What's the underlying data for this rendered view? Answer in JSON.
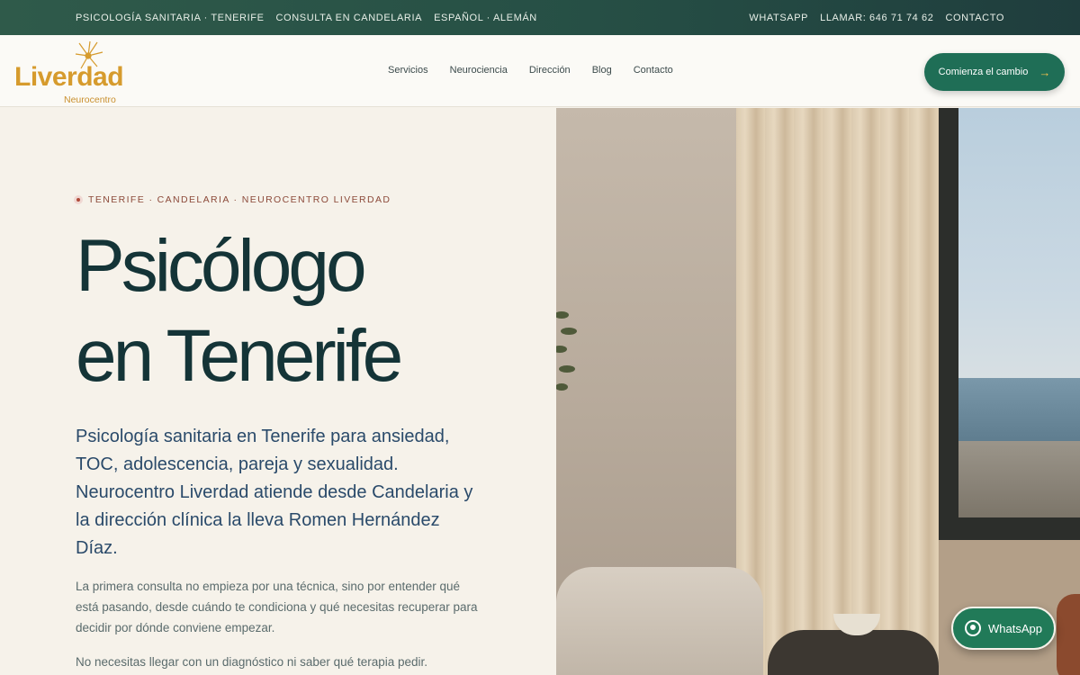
{
  "topbar": {
    "left": [
      "PSICOLOGÍA SANITARIA · TENERIFE",
      "CONSULTA EN CANDELARIA",
      "ESPAÑOL · ALEMÁN"
    ],
    "right": [
      "WHATSAPP",
      "LLAMAR: 646 71 74 62",
      "CONTACTO"
    ]
  },
  "header": {
    "logo_text": "Liverdad",
    "logo_sub": "Neurocentro",
    "nav": [
      "Servicios",
      "Neurociencia",
      "Dirección",
      "Blog",
      "Contacto"
    ],
    "cta_label": "Comienza el cambio",
    "cta_arrow": "→"
  },
  "hero": {
    "eyebrow": "TENERIFE · CANDELARIA · NEUROCENTRO LIVERDAD",
    "title_line1": "Psicólogo",
    "title_line2": "en Tenerife",
    "lead": "Psicología sanitaria en Tenerife para ansiedad, TOC, adolescencia, pareja y sexualidad. Neurocentro Liverdad atiende desde Candelaria y la dirección clínica la lleva Romen Hernández Díaz.",
    "body1": "La primera consulta no empieza por una técnica, sino por entender qué está pasando, desde cuándo te condiciona y qué necesitas recuperar para decidir por dónde conviene empezar.",
    "body2": "No necesitas llegar con un diagnóstico ni saber qué terapia pedir."
  },
  "floating": {
    "whatsapp_label": "WhatsApp"
  },
  "colors": {
    "brand_green": "#1f6e56",
    "logo_gold": "#d69b2d",
    "title_ink": "#143437",
    "background": "#f6f2ea"
  },
  "icons": {
    "cta": "arrow-right-icon",
    "whatsapp": "whatsapp-icon",
    "logo": "neuron-icon",
    "eyebrow": "location-dot-icon"
  }
}
